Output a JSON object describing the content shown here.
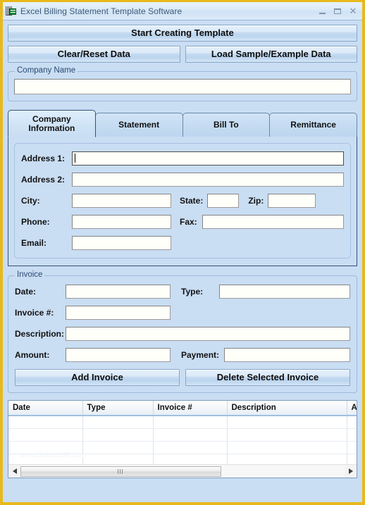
{
  "window": {
    "title": "Excel Billing Statement Template Software",
    "icon": "excel-spreadsheet-icon",
    "controls": {
      "minimize": "minimize-icon",
      "maximize": "maximize-icon",
      "close": "close-icon"
    },
    "accent_border": "#e8b91c",
    "background": "#c9ddf3",
    "titlebar_text_color": "#3e5b77"
  },
  "toolbar": {
    "start_label": "Start Creating Template",
    "clear_label": "Clear/Reset Data",
    "load_sample_label": "Load Sample/Example Data"
  },
  "company_name_group": {
    "title": "Company Name",
    "input_value": "",
    "placeholder": ""
  },
  "tabs": {
    "selected_index": 0,
    "items": [
      {
        "label": "Company\nInformation",
        "line1": "Company",
        "line2": "Information"
      },
      {
        "label": "Statement",
        "line1": "Statement",
        "line2": ""
      },
      {
        "label": "Bill To",
        "line1": "Bill To",
        "line2": ""
      },
      {
        "label": "Remittance",
        "line1": "Remittance",
        "line2": ""
      }
    ]
  },
  "company_information": {
    "fields": {
      "address1_label": "Address 1:",
      "address1_value": "",
      "address2_label": "Address 2:",
      "address2_value": "",
      "city_label": "City:",
      "city_value": "",
      "state_label": "State:",
      "state_value": "",
      "zip_label": "Zip:",
      "zip_value": "",
      "phone_label": "Phone:",
      "phone_value": "",
      "fax_label": "Fax:",
      "fax_value": "",
      "email_label": "Email:",
      "email_value": ""
    },
    "focused_field": "address1"
  },
  "invoice_group": {
    "title": "Invoice",
    "date_label": "Date:",
    "date_value": "",
    "type_label": "Type:",
    "type_value": "",
    "invoice_number_label": "Invoice #:",
    "invoice_number_value": "",
    "description_label": "Description:",
    "description_value": "",
    "amount_label": "Amount:",
    "amount_value": "",
    "payment_label": "Payment:",
    "payment_value": "",
    "add_button_label": "Add Invoice",
    "delete_button_label": "Delete Selected Invoice"
  },
  "invoice_table": {
    "columns": [
      "Date",
      "Type",
      "Invoice #",
      "Description",
      "A"
    ],
    "rows": [],
    "empty_row_count": 6,
    "watermark": "www.sobolsoft.com",
    "scrollbar": {
      "left_arrow": "scroll-left-icon",
      "right_arrow": "scroll-right-icon",
      "thumb_position_percent": 0
    }
  }
}
